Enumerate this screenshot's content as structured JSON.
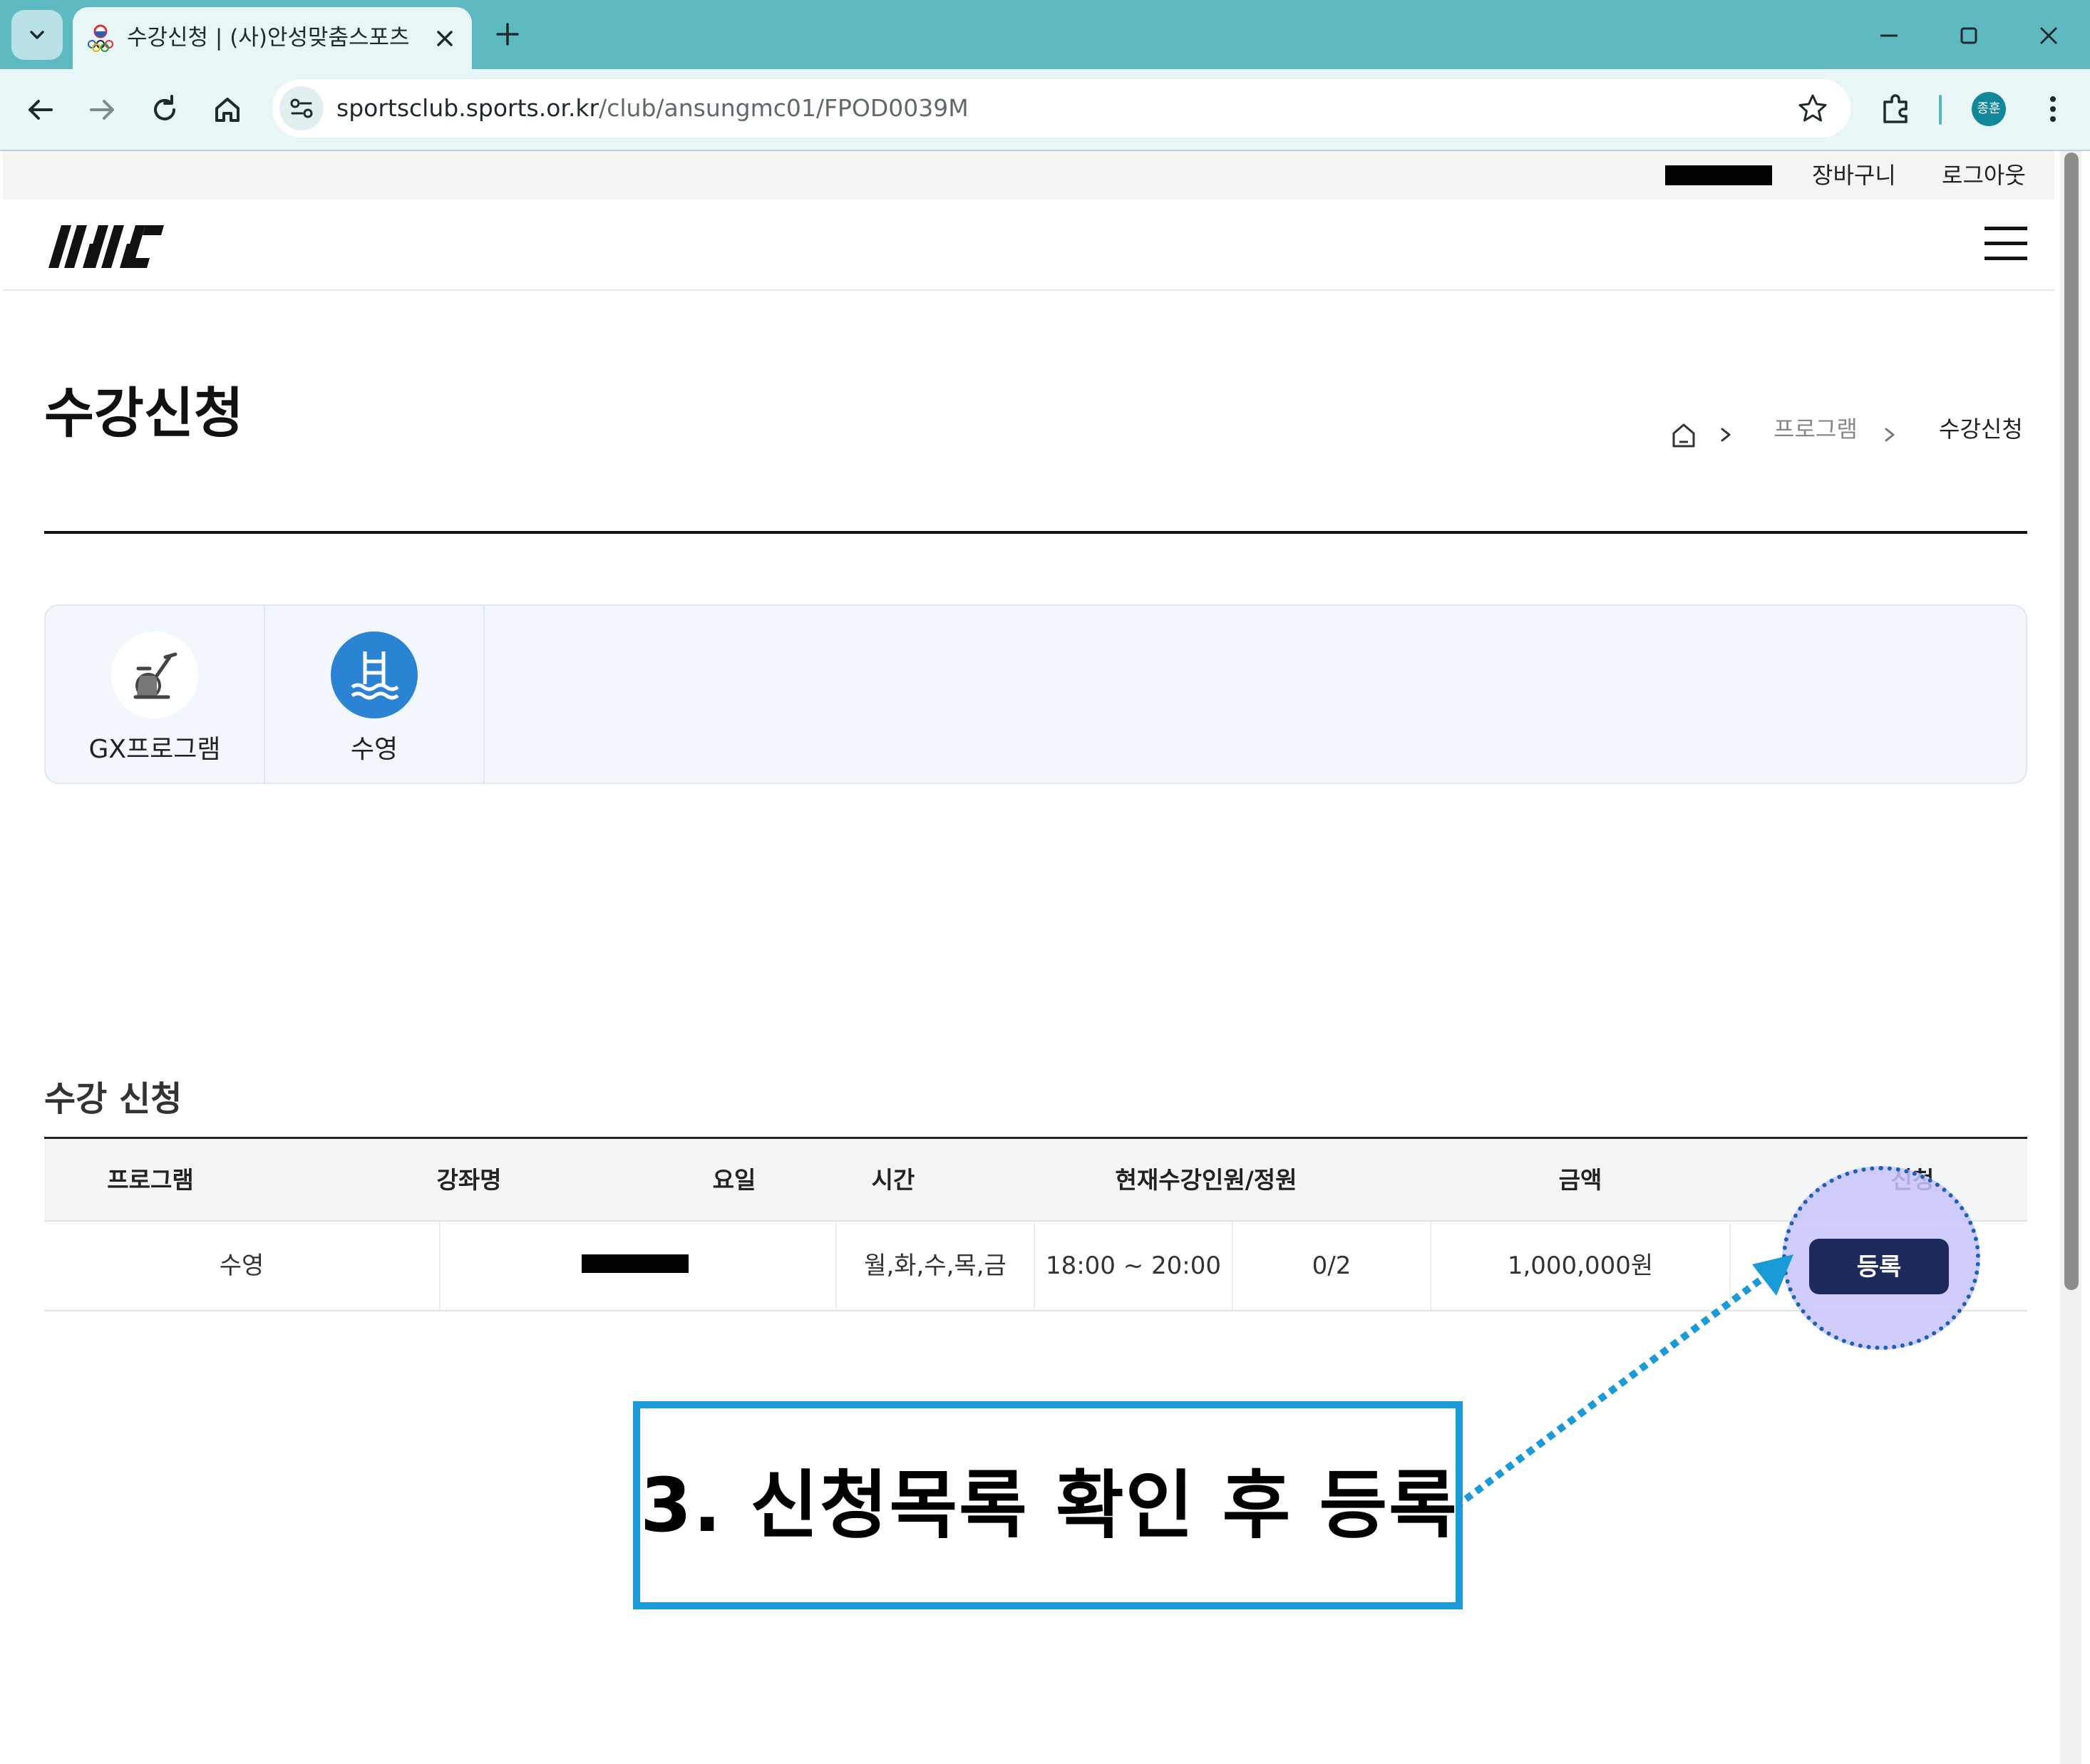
{
  "browser": {
    "tab_title": "수강신청 | (사)안성맞춤스포츠",
    "url_host": "sportsclub.sports.or.kr",
    "url_path": "/club/ansungmc01/FPOD0039M",
    "profile_label": "종훈"
  },
  "site": {
    "util_links": {
      "cart": "장바구니",
      "logout": "로그아웃"
    },
    "page_title": "수강신청",
    "breadcrumb": {
      "level1": "프로그램",
      "current": "수강신청"
    },
    "categories": [
      {
        "label": "GX프로그램",
        "icon": "exercise-bike-icon",
        "active": false
      },
      {
        "label": "수영",
        "icon": "swimming-pool-icon",
        "active": true,
        "color": "#2b83d3"
      }
    ],
    "section_title": "수강 신청",
    "table": {
      "headers": {
        "program": "프로그램",
        "course": "강좌명",
        "days": "요일",
        "time": "시간",
        "enrollment": "현재수강인원/정원",
        "price": "금액",
        "apply": "신청"
      },
      "row": {
        "program": "수영",
        "days": "월,화,수,목,금",
        "time": "18:00 ~ 20:00",
        "enrollment": "0/2",
        "price": "1,000,000원",
        "button": "등록"
      }
    }
  },
  "annotation": {
    "callout": "3. 신청목록 확인 후 등록",
    "accent_color": "#1a9ad6"
  }
}
